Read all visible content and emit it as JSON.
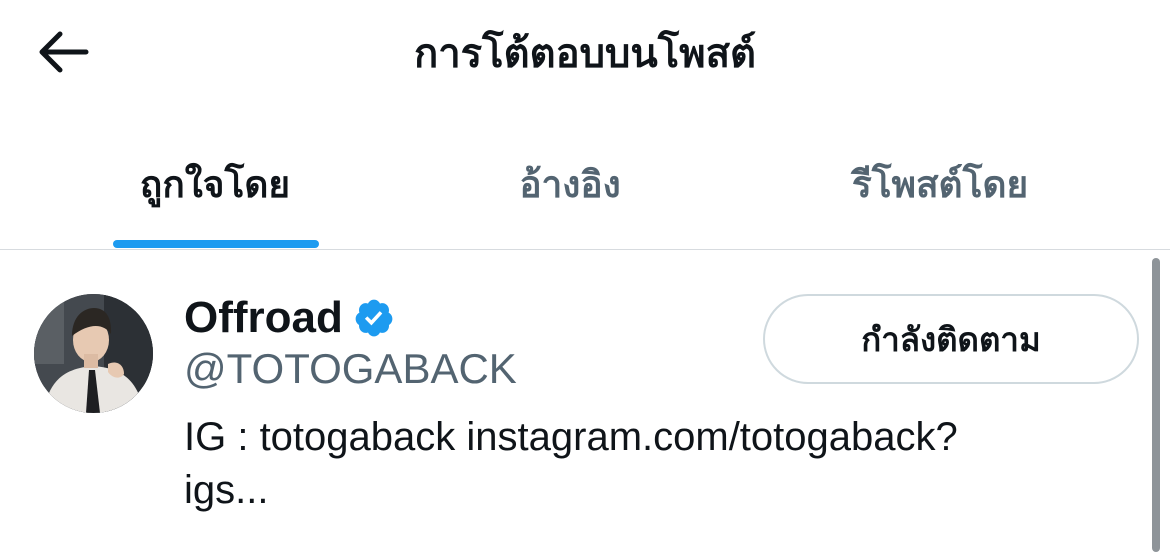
{
  "header": {
    "back_icon": "arrow-left-icon",
    "title": "การโต้ตอบบนโพสต์"
  },
  "tabs": [
    {
      "label": "ถูกใจโดย",
      "active": true
    },
    {
      "label": "อ้างอิง",
      "active": false
    },
    {
      "label": "รีโพสต์โดย",
      "active": false
    }
  ],
  "user": {
    "display_name": "Offroad",
    "verified_icon": "verified-badge-icon",
    "handle": "@TOTOGABACK",
    "bio_line1": "IG : totogaback instagram.com/totogaback?",
    "bio_line2": "igs...",
    "follow_label": "กำลังติดตาม"
  },
  "colors": {
    "accent": "#1d9bf0",
    "text_primary": "#0f1419",
    "text_secondary": "#536471",
    "border": "#cfd9de"
  }
}
